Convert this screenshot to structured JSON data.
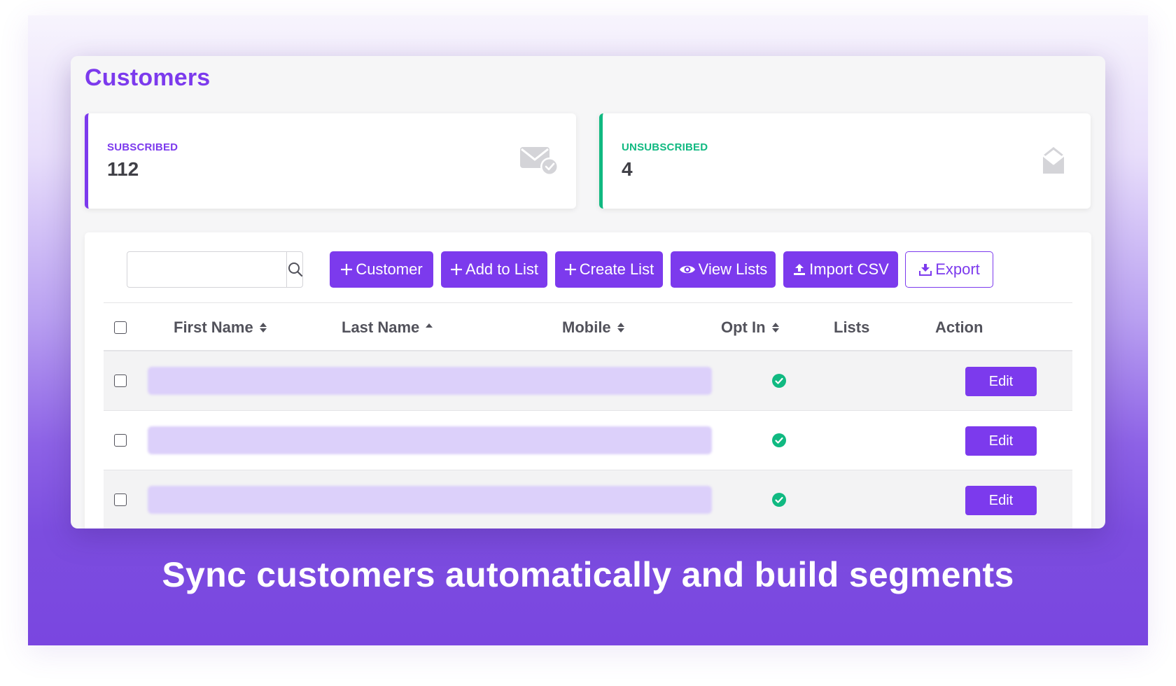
{
  "page": {
    "title": "Customers",
    "tagline": "Sync customers automatically and build segments"
  },
  "stats": {
    "subscribed": {
      "label": "SUBSCRIBED",
      "value": "112",
      "icon": "envelope-check-icon",
      "color": "#7c3aed"
    },
    "unsubscribed": {
      "label": "UNSUBSCRIBED",
      "value": "4",
      "icon": "envelope-open-icon",
      "color": "#10b981"
    }
  },
  "search": {
    "placeholder": "",
    "value": ""
  },
  "toolbar": {
    "customer_label": "Customer",
    "add_to_list_label": "Add to List",
    "create_list_label": "Create List",
    "view_lists_label": "View Lists",
    "import_csv_label": "Import CSV",
    "export_label": "Export"
  },
  "table": {
    "columns": [
      {
        "label": "First Name",
        "sort": "both"
      },
      {
        "label": "Last Name",
        "sort": "asc"
      },
      {
        "label": "Mobile",
        "sort": "both"
      },
      {
        "label": "Opt In",
        "sort": "both"
      },
      {
        "label": "Lists",
        "sort": "none"
      },
      {
        "label": "Action",
        "sort": "none"
      }
    ],
    "rows": [
      {
        "opt_in": true,
        "action_label": "Edit"
      },
      {
        "opt_in": true,
        "action_label": "Edit"
      },
      {
        "opt_in": true,
        "action_label": "Edit"
      }
    ]
  },
  "colors": {
    "accent": "#7c3aed",
    "success": "#10b981",
    "blurred_row": "#dcd0fa"
  }
}
